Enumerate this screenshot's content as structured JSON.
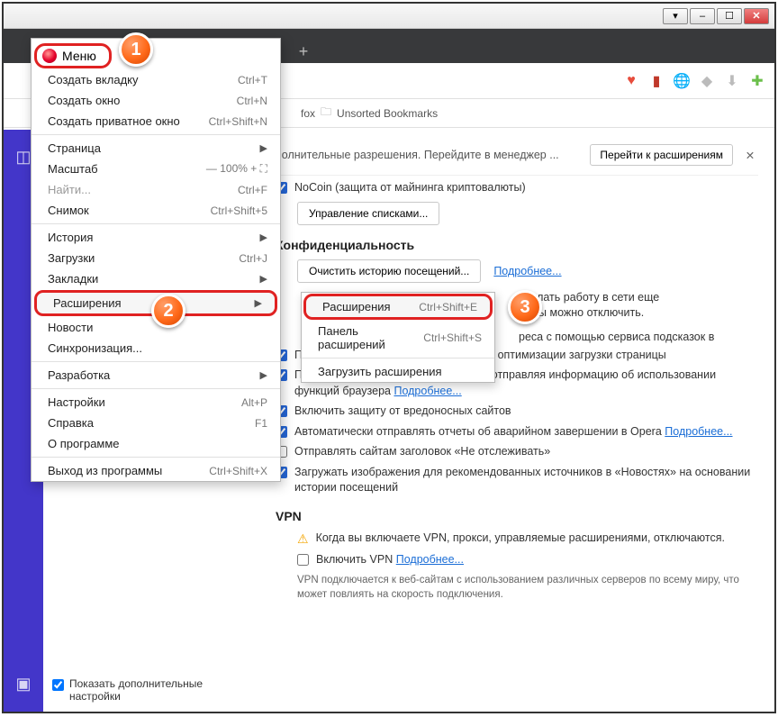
{
  "window": {
    "min": "–",
    "max": "☐",
    "close": "✕",
    "aero": "▾"
  },
  "tabbar": {
    "newtab": "+"
  },
  "addrbar": {
    "icons": {
      "heart": "♥",
      "book": "▮",
      "globe": "🌐",
      "shield": "◆",
      "down": "⬇",
      "ext": "✚"
    }
  },
  "bookbar": {
    "folder_item": "fox",
    "folder2": "Unsorted Bookmarks"
  },
  "banner": {
    "text": "полнительные разрешения. Перейдите в менеджер ...",
    "button": "Перейти к расширениям",
    "close": "✕"
  },
  "nocoin": {
    "label": "NoCoin (защита от майнинга криптовалюты)"
  },
  "lists_btn": "Управление списками...",
  "privacy": {
    "heading": "Конфиденциальность",
    "clear_btn": "Очистить историю посещений...",
    "more": "Подробнее...",
    "line1": "сделать работу в сети еще",
    "line2": "ужбы можно отключить.",
    "line3": "реса с помощью сервиса подсказок в",
    "predict": "Предсказывать сетевые действия для оптимизации загрузки страницы",
    "help": "Помогите усовершенствовать Opera, отправляя информацию об использовании функций браузера",
    "protect": "Включить защиту от вредоносных сайтов",
    "crash": "Автоматически отправлять отчеты об аварийном завершении в Opera",
    "dnt": "Отправлять сайтам заголовок «Не отслеживать»",
    "news": "Загружать изображения для рекомендованных источников в «Новостях» на основании истории посещений"
  },
  "vpn": {
    "heading": "VPN",
    "note": "Когда вы включаете VPN, прокси, управляемые расширениями, отключаются.",
    "enable": "Включить VPN",
    "more": "Подробнее...",
    "foot": "VPN подключается к веб-сайтам с использованием различных серверов по всему миру, что может повлиять на скорость подключения."
  },
  "sideopt": {
    "label": "Показать дополнительные настройки"
  },
  "menu_button": "Меню",
  "menu": {
    "new_tab": "Создать вкладку",
    "new_tab_sc": "Ctrl+T",
    "new_win": "Создать окно",
    "new_win_sc": "Ctrl+N",
    "new_priv": "Создать приватное окно",
    "new_priv_sc": "Ctrl+Shift+N",
    "page": "Страница",
    "zoom": "Масштаб",
    "zoom_val": "— 100% +",
    "find": "Найти...",
    "find_sc": "Ctrl+F",
    "snapshot": "Снимок",
    "snapshot_sc": "Ctrl+Shift+5",
    "history": "История",
    "downloads": "Загрузки",
    "downloads_sc": "Ctrl+J",
    "bookmarks": "Закладки",
    "extensions": "Расширения",
    "news": "Новости",
    "sync": "Синхронизация...",
    "dev": "Разработка",
    "settings": "Настройки",
    "settings_sc": "Alt+P",
    "help": "Справка",
    "help_sc": "F1",
    "about": "О программе",
    "exit": "Выход из программы",
    "exit_sc": "Ctrl+Shift+X"
  },
  "submenu": {
    "ext": "Расширения",
    "ext_sc": "Ctrl+Shift+E",
    "panel": "Панель расширений",
    "panel_sc": "Ctrl+Shift+S",
    "get": "Загрузить расширения"
  },
  "badges": {
    "b1": "1",
    "b2": "2",
    "b3": "3"
  }
}
